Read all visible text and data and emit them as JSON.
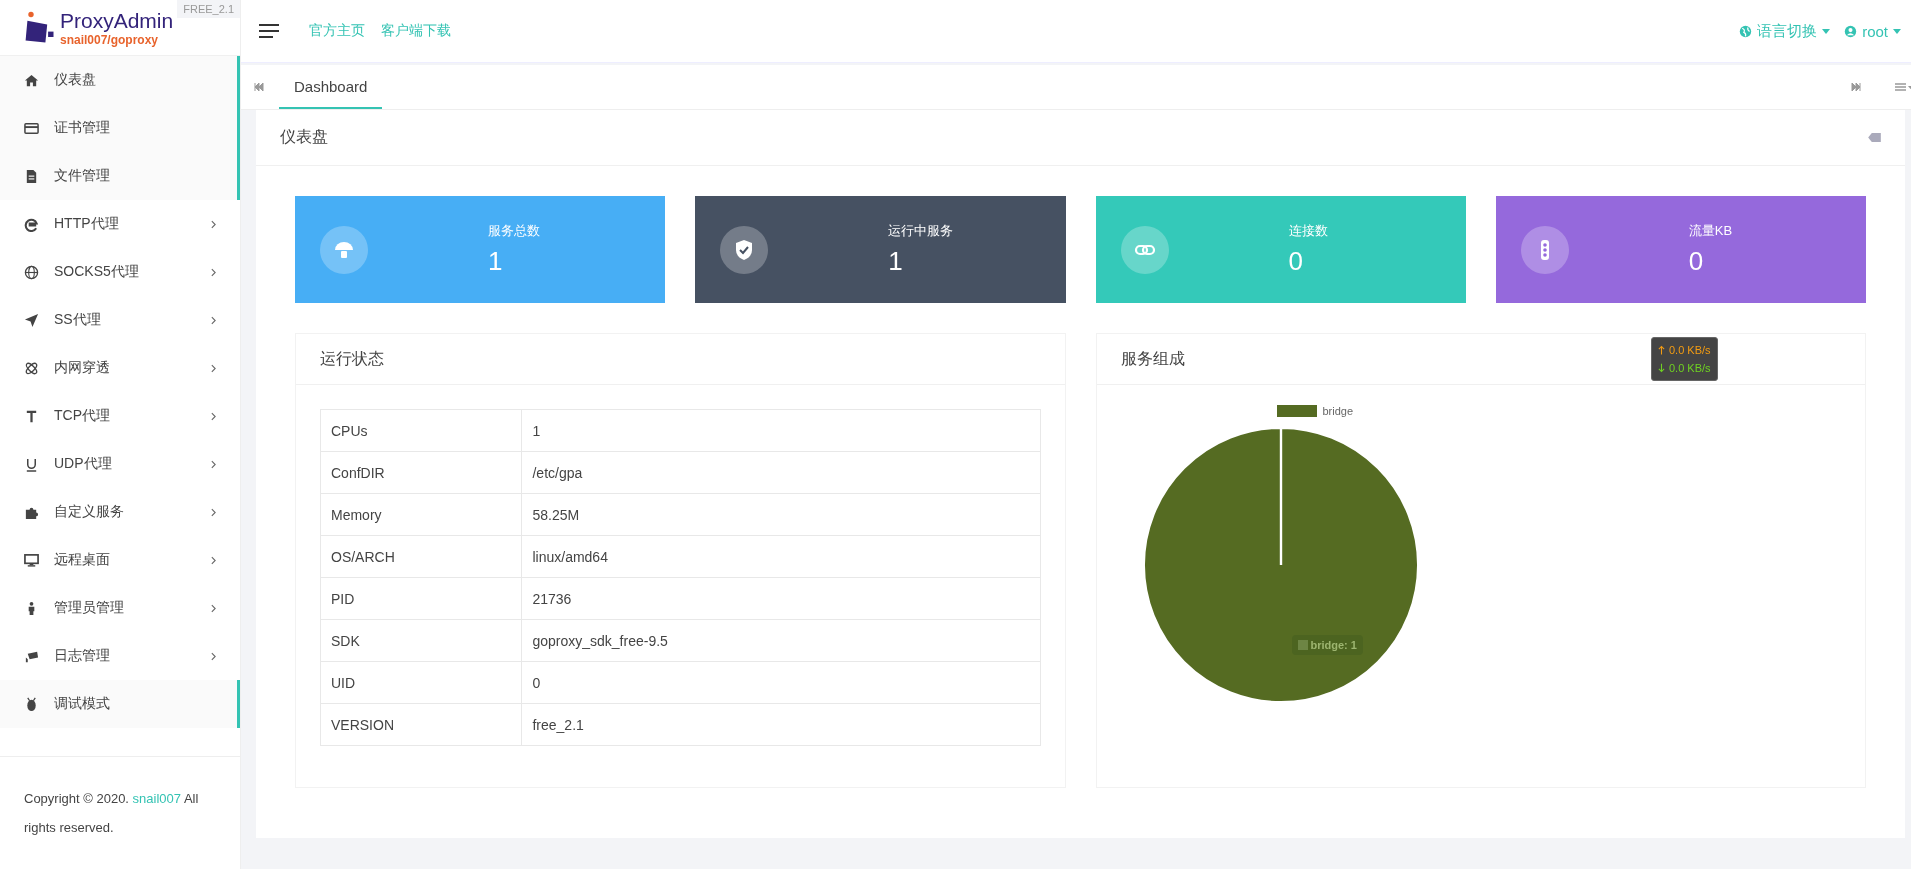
{
  "brand": {
    "name": "ProxyAdmin",
    "subtitle": "snail007/goproxy",
    "version": "FREE_2.1"
  },
  "header": {
    "links": [
      "官方主页",
      "客户端下载"
    ],
    "language": "语言切换",
    "user": "root"
  },
  "sidebar": {
    "items": [
      {
        "label": "仪表盘",
        "selected": true,
        "expandable": false
      },
      {
        "label": "证书管理",
        "selected": true,
        "expandable": false
      },
      {
        "label": "文件管理",
        "selected": true,
        "expandable": false
      },
      {
        "label": "HTTP代理",
        "selected": false,
        "expandable": true
      },
      {
        "label": "SOCKS5代理",
        "selected": false,
        "expandable": true
      },
      {
        "label": "SS代理",
        "selected": false,
        "expandable": true
      },
      {
        "label": "内网穿透",
        "selected": false,
        "expandable": true
      },
      {
        "label": "TCP代理",
        "selected": false,
        "expandable": true
      },
      {
        "label": "UDP代理",
        "selected": false,
        "expandable": true
      },
      {
        "label": "自定义服务",
        "selected": false,
        "expandable": true
      },
      {
        "label": "远程桌面",
        "selected": false,
        "expandable": true
      },
      {
        "label": "管理员管理",
        "selected": false,
        "expandable": true
      },
      {
        "label": "日志管理",
        "selected": false,
        "expandable": true
      },
      {
        "label": "调试模式",
        "selected": true,
        "expandable": false
      }
    ],
    "copyright": {
      "before": "Copyright © 2020.",
      "link": "snail007",
      "after": "All rights reserved."
    }
  },
  "tabs": [
    {
      "label": "Dashboard",
      "selected": true
    }
  ],
  "page_title": "仪表盘",
  "stats": [
    {
      "label": "服务总数",
      "value": "1",
      "color": "#47aef5"
    },
    {
      "label": "运行中服务",
      "value": "1",
      "color": "#465162"
    },
    {
      "label": "连接数",
      "value": "0",
      "color": "#34c9b9"
    },
    {
      "label": "流量KB",
      "value": "0",
      "color": "#9569dc"
    }
  ],
  "status_panel": {
    "title": "运行状态",
    "rows": [
      [
        "CPUs",
        "1"
      ],
      [
        "ConfDIR",
        "/etc/gpa"
      ],
      [
        "Memory",
        "58.25M"
      ],
      [
        "OS/ARCH",
        "linux/amd64"
      ],
      [
        "PID",
        "21736"
      ],
      [
        "SDK",
        "goproxy_sdk_free-9.5"
      ],
      [
        "UID",
        "0"
      ],
      [
        "VERSION",
        "free_2.1"
      ]
    ]
  },
  "service_panel": {
    "title": "服务组成",
    "chart_data": {
      "type": "pie",
      "categories": [
        "bridge"
      ],
      "series": [
        {
          "color": "#556b22",
          "values": [
            1
          ]
        }
      ],
      "data_labels": true
    },
    "tooltip": {
      "label": "bridge:"
    }
  },
  "speed": {
    "up": "0.0 KB/s",
    "down": "0.0 KB/s"
  }
}
